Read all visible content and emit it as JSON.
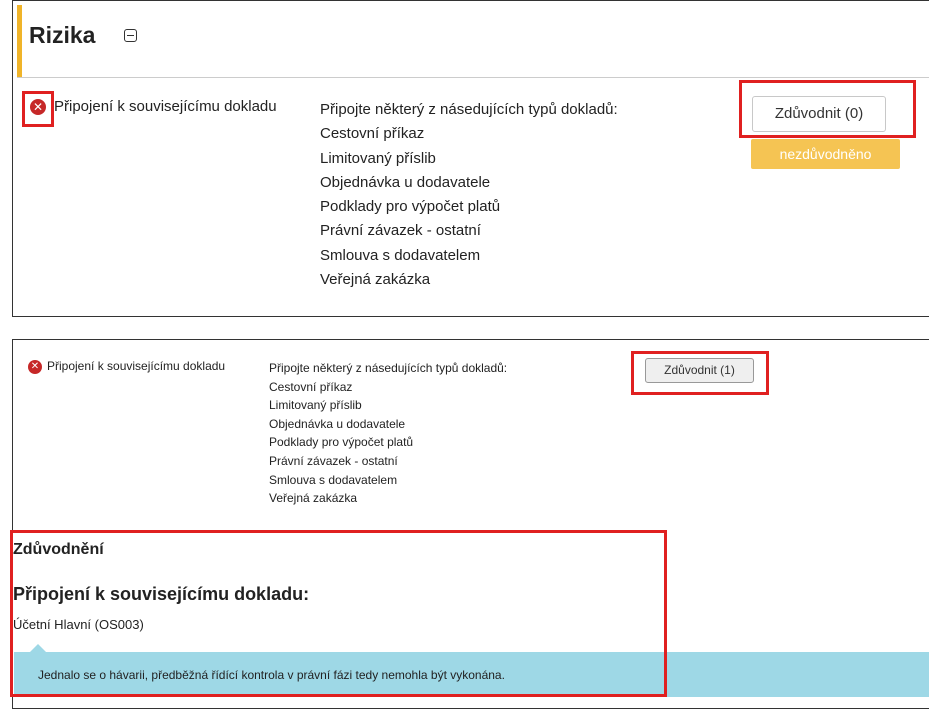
{
  "section": {
    "title": "Rizika"
  },
  "top_row": {
    "label": "Připojení k souvisejícímu dokladu",
    "instruction": "Připojte některý z násedujících typů dokladů:",
    "doc_types": [
      "Cestovní příkaz",
      "Limitovaný příslib",
      "Objednávka u dodavatele",
      "Podklady pro výpočet platů",
      "Právní závazek - ostatní",
      "Smlouva s dodavatelem",
      "Veřejná zakázka"
    ],
    "button_label": "Zdůvodnit (0)",
    "status_badge": "nezdůvodněno"
  },
  "bottom_row": {
    "label": "Připojení k souvisejícímu dokladu",
    "instruction": "Připojte některý z násedujících typů dokladů:",
    "doc_types": [
      "Cestovní příkaz",
      "Limitovaný příslib",
      "Objednávka u dodavatele",
      "Podklady pro výpočet platů",
      "Právní závazek - ostatní",
      "Smlouva s dodavatelem",
      "Veřejná zakázka"
    ],
    "button_label": "Zdůvodnit (1)"
  },
  "justification": {
    "heading": "Zdůvodnění",
    "subheading": "Připojení k souvisejícímu dokladu:",
    "account": "Účetní Hlavní (OS003)",
    "note": "Jednalo se o hávarii, předběžná řídící kontrola v právní fázi tedy nemohla být vykonána."
  },
  "icons": {
    "error": "x-circle-icon",
    "collapse": "minus-square-icon"
  },
  "colors": {
    "accent": "#f0b429",
    "error": "#c62828",
    "highlight": "#e02020",
    "badge": "#f5c453",
    "note_bg": "#9ed8e6"
  }
}
